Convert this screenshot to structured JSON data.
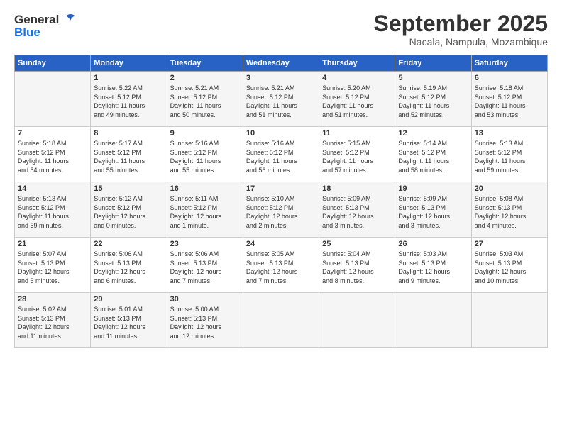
{
  "header": {
    "logo_line1": "General",
    "logo_line2": "Blue",
    "month": "September 2025",
    "location": "Nacala, Nampula, Mozambique"
  },
  "days_of_week": [
    "Sunday",
    "Monday",
    "Tuesday",
    "Wednesday",
    "Thursday",
    "Friday",
    "Saturday"
  ],
  "weeks": [
    [
      {
        "day": "",
        "info": ""
      },
      {
        "day": "1",
        "info": "Sunrise: 5:22 AM\nSunset: 5:12 PM\nDaylight: 11 hours\nand 49 minutes."
      },
      {
        "day": "2",
        "info": "Sunrise: 5:21 AM\nSunset: 5:12 PM\nDaylight: 11 hours\nand 50 minutes."
      },
      {
        "day": "3",
        "info": "Sunrise: 5:21 AM\nSunset: 5:12 PM\nDaylight: 11 hours\nand 51 minutes."
      },
      {
        "day": "4",
        "info": "Sunrise: 5:20 AM\nSunset: 5:12 PM\nDaylight: 11 hours\nand 51 minutes."
      },
      {
        "day": "5",
        "info": "Sunrise: 5:19 AM\nSunset: 5:12 PM\nDaylight: 11 hours\nand 52 minutes."
      },
      {
        "day": "6",
        "info": "Sunrise: 5:18 AM\nSunset: 5:12 PM\nDaylight: 11 hours\nand 53 minutes."
      }
    ],
    [
      {
        "day": "7",
        "info": "Sunrise: 5:18 AM\nSunset: 5:12 PM\nDaylight: 11 hours\nand 54 minutes."
      },
      {
        "day": "8",
        "info": "Sunrise: 5:17 AM\nSunset: 5:12 PM\nDaylight: 11 hours\nand 55 minutes."
      },
      {
        "day": "9",
        "info": "Sunrise: 5:16 AM\nSunset: 5:12 PM\nDaylight: 11 hours\nand 55 minutes."
      },
      {
        "day": "10",
        "info": "Sunrise: 5:16 AM\nSunset: 5:12 PM\nDaylight: 11 hours\nand 56 minutes."
      },
      {
        "day": "11",
        "info": "Sunrise: 5:15 AM\nSunset: 5:12 PM\nDaylight: 11 hours\nand 57 minutes."
      },
      {
        "day": "12",
        "info": "Sunrise: 5:14 AM\nSunset: 5:12 PM\nDaylight: 11 hours\nand 58 minutes."
      },
      {
        "day": "13",
        "info": "Sunrise: 5:13 AM\nSunset: 5:12 PM\nDaylight: 11 hours\nand 59 minutes."
      }
    ],
    [
      {
        "day": "14",
        "info": "Sunrise: 5:13 AM\nSunset: 5:12 PM\nDaylight: 11 hours\nand 59 minutes."
      },
      {
        "day": "15",
        "info": "Sunrise: 5:12 AM\nSunset: 5:12 PM\nDaylight: 12 hours\nand 0 minutes."
      },
      {
        "day": "16",
        "info": "Sunrise: 5:11 AM\nSunset: 5:12 PM\nDaylight: 12 hours\nand 1 minute."
      },
      {
        "day": "17",
        "info": "Sunrise: 5:10 AM\nSunset: 5:12 PM\nDaylight: 12 hours\nand 2 minutes."
      },
      {
        "day": "18",
        "info": "Sunrise: 5:09 AM\nSunset: 5:13 PM\nDaylight: 12 hours\nand 3 minutes."
      },
      {
        "day": "19",
        "info": "Sunrise: 5:09 AM\nSunset: 5:13 PM\nDaylight: 12 hours\nand 3 minutes."
      },
      {
        "day": "20",
        "info": "Sunrise: 5:08 AM\nSunset: 5:13 PM\nDaylight: 12 hours\nand 4 minutes."
      }
    ],
    [
      {
        "day": "21",
        "info": "Sunrise: 5:07 AM\nSunset: 5:13 PM\nDaylight: 12 hours\nand 5 minutes."
      },
      {
        "day": "22",
        "info": "Sunrise: 5:06 AM\nSunset: 5:13 PM\nDaylight: 12 hours\nand 6 minutes."
      },
      {
        "day": "23",
        "info": "Sunrise: 5:06 AM\nSunset: 5:13 PM\nDaylight: 12 hours\nand 7 minutes."
      },
      {
        "day": "24",
        "info": "Sunrise: 5:05 AM\nSunset: 5:13 PM\nDaylight: 12 hours\nand 7 minutes."
      },
      {
        "day": "25",
        "info": "Sunrise: 5:04 AM\nSunset: 5:13 PM\nDaylight: 12 hours\nand 8 minutes."
      },
      {
        "day": "26",
        "info": "Sunrise: 5:03 AM\nSunset: 5:13 PM\nDaylight: 12 hours\nand 9 minutes."
      },
      {
        "day": "27",
        "info": "Sunrise: 5:03 AM\nSunset: 5:13 PM\nDaylight: 12 hours\nand 10 minutes."
      }
    ],
    [
      {
        "day": "28",
        "info": "Sunrise: 5:02 AM\nSunset: 5:13 PM\nDaylight: 12 hours\nand 11 minutes."
      },
      {
        "day": "29",
        "info": "Sunrise: 5:01 AM\nSunset: 5:13 PM\nDaylight: 12 hours\nand 11 minutes."
      },
      {
        "day": "30",
        "info": "Sunrise: 5:00 AM\nSunset: 5:13 PM\nDaylight: 12 hours\nand 12 minutes."
      },
      {
        "day": "",
        "info": ""
      },
      {
        "day": "",
        "info": ""
      },
      {
        "day": "",
        "info": ""
      },
      {
        "day": "",
        "info": ""
      }
    ]
  ]
}
